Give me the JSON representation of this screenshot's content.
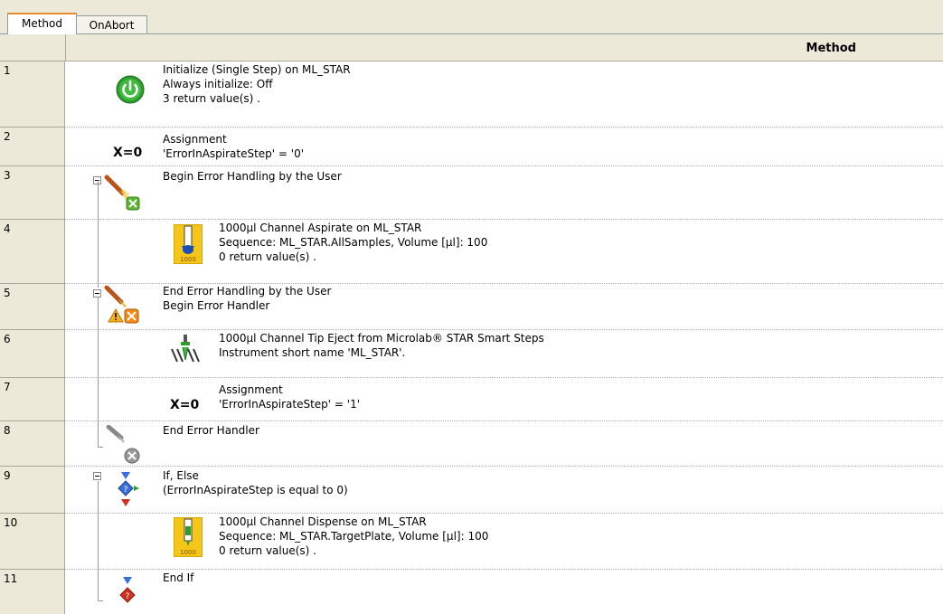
{
  "tabs": [
    {
      "label": "Method",
      "active": true
    },
    {
      "label": "OnAbort",
      "active": false
    }
  ],
  "header": {
    "title": "Method"
  },
  "rows": [
    {
      "num": "1",
      "lines": [
        "Initialize (Single Step) on ML_STAR",
        "Always initialize: Off",
        "3 return value(s) ."
      ],
      "icon": "power-icon"
    },
    {
      "num": "2",
      "lines": [
        "Assignment",
        "'ErrorInAspirateStep' = '0'"
      ],
      "icon": "assignment-icon",
      "icon_text": "X=0"
    },
    {
      "num": "3",
      "lines": [
        "Begin Error Handling by the User"
      ],
      "icon": "error-handling-begin-icon"
    },
    {
      "num": "4",
      "lines": [
        "1000µl Channel Aspirate on ML_STAR",
        "Sequence: ML_STAR.AllSamples, Volume [µl]: 100",
        "0 return value(s) ."
      ],
      "icon": "aspirate-icon",
      "icon_text": "1000"
    },
    {
      "num": "5",
      "lines": [
        "End Error Handling by the User",
        "Begin Error Handler"
      ],
      "icon": "error-handler-begin-icon"
    },
    {
      "num": "6",
      "lines": [
        "1000µl Channel Tip Eject from Microlab® STAR Smart Steps",
        "Instrument short name 'ML_STAR'."
      ],
      "icon": "tip-eject-icon"
    },
    {
      "num": "7",
      "lines": [
        "Assignment",
        "'ErrorInAspirateStep' = '1'"
      ],
      "icon": "assignment-icon",
      "icon_text": "X=0"
    },
    {
      "num": "8",
      "lines": [
        "End Error Handler"
      ],
      "icon": "error-handler-end-icon"
    },
    {
      "num": "9",
      "lines": [
        "If, Else",
        "(ErrorInAspirateStep is equal to 0)"
      ],
      "icon": "if-else-icon"
    },
    {
      "num": "10",
      "lines": [
        "1000µl Channel Dispense on ML_STAR",
        "Sequence: ML_STAR.TargetPlate, Volume [µl]: 100",
        "0 return value(s) ."
      ],
      "icon": "dispense-icon",
      "icon_text": "1000"
    },
    {
      "num": "11",
      "lines": [
        "End If"
      ],
      "icon": "end-if-icon"
    }
  ]
}
